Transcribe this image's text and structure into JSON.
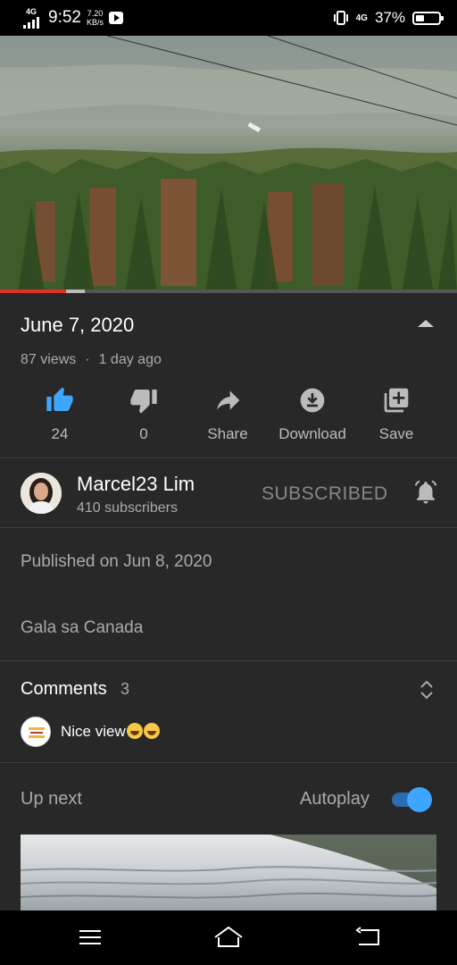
{
  "status_bar": {
    "network": "4G",
    "time": "9:52",
    "speed_value": "7.20",
    "speed_unit": "KB/s",
    "network_right": "4G",
    "battery": "37%",
    "battery_level": 0.37
  },
  "video": {
    "progress_played": 0.145,
    "progress_buffered": 0.185
  },
  "info": {
    "title": "June 7, 2020",
    "views": "87 views",
    "separator": "·",
    "age": "1 day ago"
  },
  "actions": [
    {
      "name": "like",
      "label": "24",
      "icon": "thumbs-up-icon"
    },
    {
      "name": "dislike",
      "label": "0",
      "icon": "thumbs-down-icon"
    },
    {
      "name": "share",
      "label": "Share",
      "icon": "share-icon"
    },
    {
      "name": "download",
      "label": "Download",
      "icon": "download-icon"
    },
    {
      "name": "save",
      "label": "Save",
      "icon": "playlist-add-icon"
    }
  ],
  "channel": {
    "name": "Marcel23 Lim",
    "subscribers": "410 subscribers",
    "subscribe_state": "SUBSCRIBED"
  },
  "description": {
    "published": "Published on Jun 8, 2020",
    "text": "Gala sa Canada"
  },
  "comments": {
    "label": "Comments",
    "count": "3",
    "top_comment": "Nice view"
  },
  "up_next": {
    "label": "Up next",
    "autoplay_label": "Autoplay",
    "autoplay_on": true
  },
  "colors": {
    "background": "#282828",
    "accent_blue": "#3ea6ff",
    "progress_red": "#e52d27",
    "text_secondary": "#aaaaaa"
  }
}
